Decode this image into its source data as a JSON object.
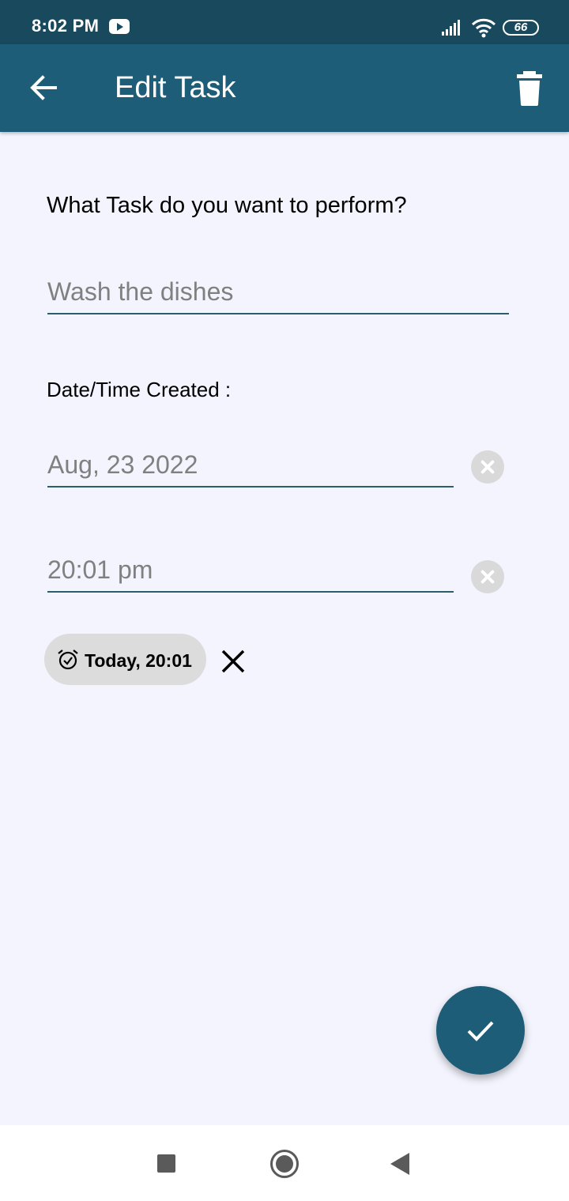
{
  "status_bar": {
    "time": "8:02 PM",
    "battery": "66",
    "icons": [
      "youtube-icon",
      "signal-icon",
      "wifi-icon",
      "battery-icon"
    ]
  },
  "app_bar": {
    "title": "Edit Task",
    "back_icon": "arrow-left-icon",
    "delete_icon": "trash-icon",
    "color": "#1d5d78"
  },
  "form": {
    "question": "What Task do you want to perform?",
    "task_input": {
      "placeholder": "Wash the dishes",
      "value": ""
    },
    "datetime_label": "Date/Time Created :",
    "date_input": {
      "placeholder": "Aug, 23 2022",
      "value": ""
    },
    "time_input": {
      "placeholder": "20:01 pm",
      "value": ""
    },
    "clear_icon": "clear-circle-icon"
  },
  "reminder_chip": {
    "label": "Today, 20:01",
    "icon": "alarm-icon",
    "remove_icon": "close-icon"
  },
  "fab": {
    "icon": "check-icon",
    "color": "#1d5d78"
  },
  "nav_bar": {
    "icons": [
      "recents-square-icon",
      "home-circle-icon",
      "back-triangle-icon"
    ]
  },
  "colors": {
    "status_bar": "#18495d",
    "app_bar": "#1d5d78",
    "background": "#f3f4fd",
    "underline": "#2a5d6e"
  }
}
